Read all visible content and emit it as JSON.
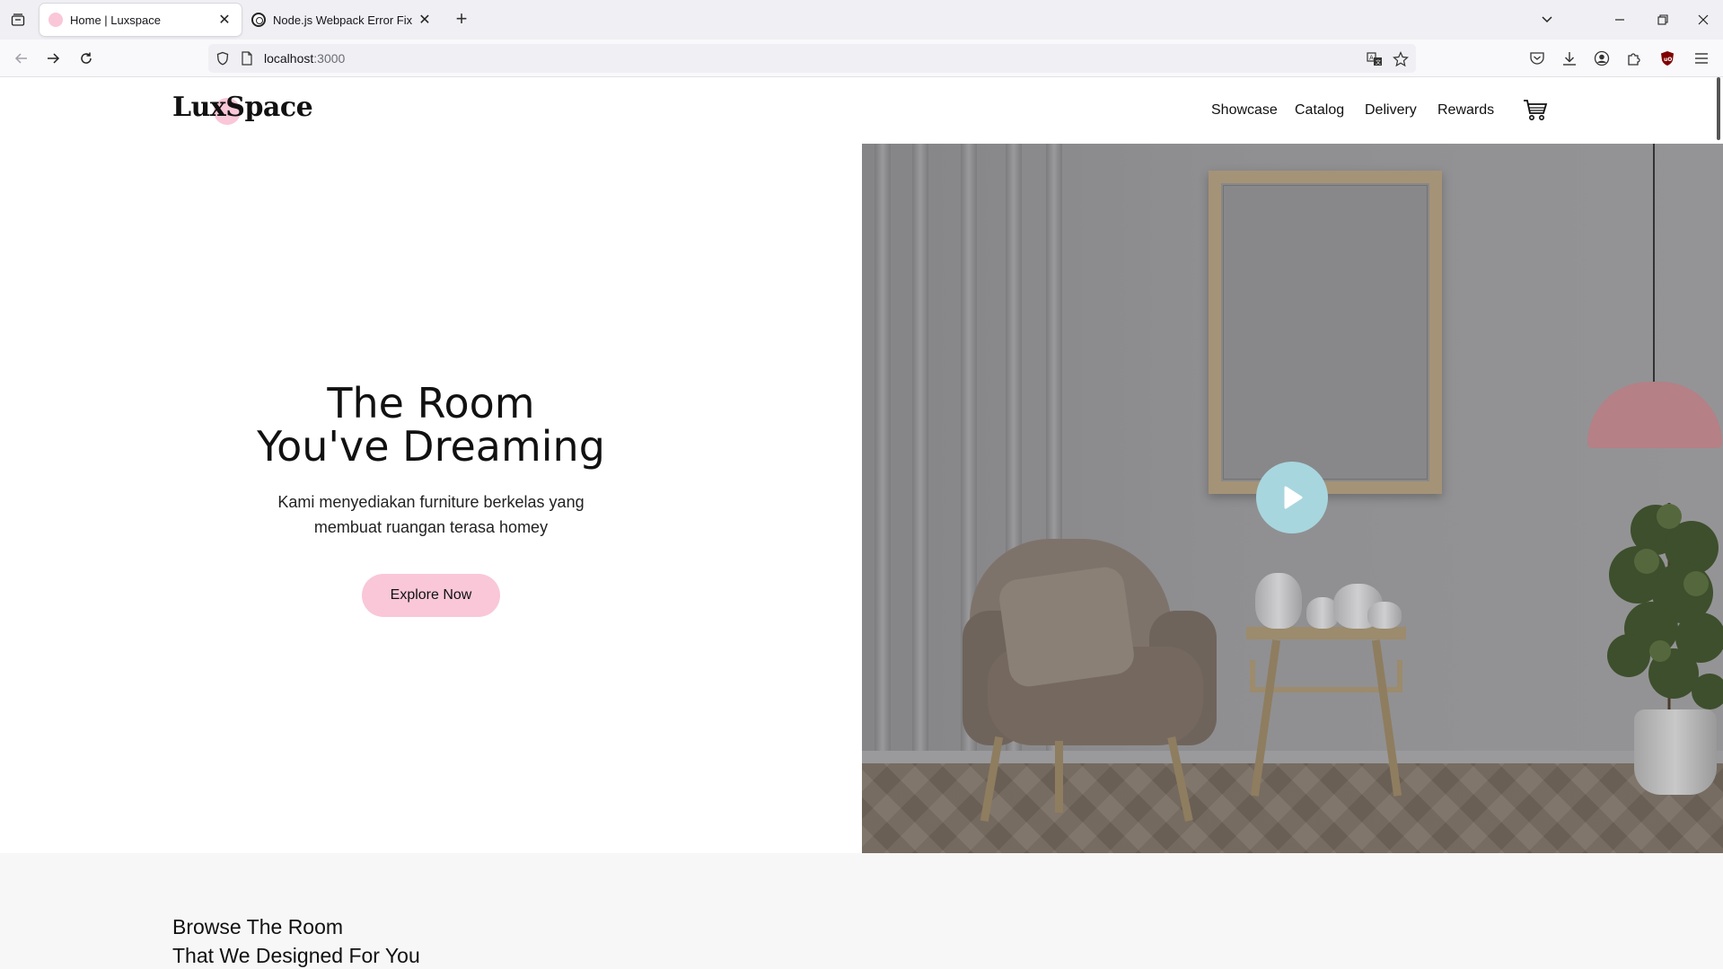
{
  "browser": {
    "tabs": [
      {
        "title": "Home | Luxspace",
        "active": true
      },
      {
        "title": "Node.js Webpack Error Fix",
        "active": false
      }
    ],
    "url_host": "localhost",
    "url_port": ":3000"
  },
  "site": {
    "logo": "LuxSpace",
    "nav": [
      "Showcase",
      "Catalog",
      "Delivery",
      "Rewards"
    ],
    "accent_color": "#f9c7d8",
    "play_color": "#a8d6de"
  },
  "hero": {
    "title_line1": "The Room",
    "title_line2": "You've Dreaming",
    "subtitle_line1": "Kami menyediakan furniture berkelas yang",
    "subtitle_line2": "membuat ruangan terasa homey",
    "cta_label": "Explore Now"
  },
  "browse": {
    "line1": "Browse The Room",
    "line2": "That We Designed For You"
  }
}
